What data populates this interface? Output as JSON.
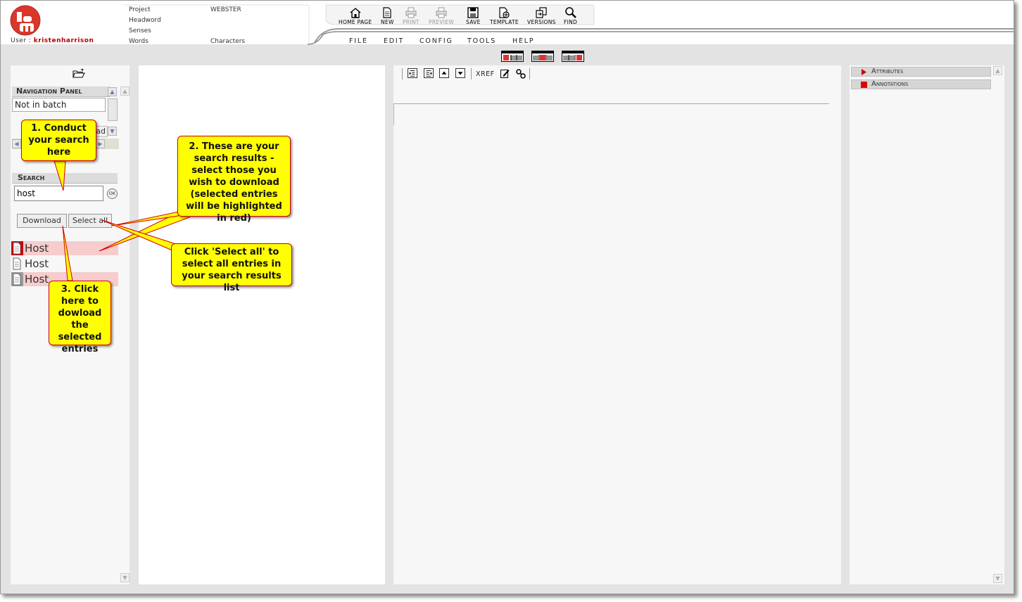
{
  "header": {
    "user_label": "User :",
    "username": "kristenharrison",
    "info": {
      "project_label": "Project",
      "project_value": "WEBSTER",
      "headword_label": "Headword",
      "senses_label": "Senses",
      "words_label": "Words",
      "characters_label": "Characters"
    },
    "toolbar": [
      {
        "label": "HOME PAGE",
        "icon": "home-icon"
      },
      {
        "label": "NEW",
        "icon": "new-document-icon"
      },
      {
        "label": "PRINT",
        "icon": "printer-icon",
        "disabled": true
      },
      {
        "label": "PREVIEW",
        "icon": "preview-icon",
        "disabled": true
      },
      {
        "label": "SAVE",
        "icon": "floppy-disk-icon"
      },
      {
        "label": "TEMPLATE",
        "icon": "template-icon"
      },
      {
        "label": "VERSIONS",
        "icon": "versions-icon"
      },
      {
        "label": "FIND",
        "icon": "magnifier-icon"
      }
    ],
    "menu": [
      "FILE",
      "EDIT",
      "CONFIG",
      "TOOLS",
      "HELP"
    ]
  },
  "left_panel": {
    "navigation_title": "Navigation Panel",
    "nav_list_item": "Not in batch",
    "nav_partial_button": "ad",
    "search_title": "Search",
    "search_value": "host",
    "ok_label": "OK",
    "download_label": "Download",
    "select_all_label": "Select all",
    "results": [
      {
        "label": "Host",
        "selected": true
      },
      {
        "label": "Host",
        "selected": false
      },
      {
        "label": "Host",
        "selected": true
      }
    ]
  },
  "editor": {
    "xref_label": "XREF"
  },
  "right_panel": {
    "sections": [
      "Attributes",
      "Annotations"
    ]
  },
  "callouts": {
    "c1": "1. Conduct your search here",
    "c2": "2. These are your search results - select those you wish to download (selected entries will be highlighted in red)",
    "c3": "Click 'Select all' to select all entries in your search results list",
    "c4": "3. Click here to dowload the selected entries"
  },
  "colors": {
    "accent_red": "#b40000",
    "selected_row": "#f6cccc",
    "callout_fill": "#ffff00",
    "callout_border": "#d40000"
  }
}
